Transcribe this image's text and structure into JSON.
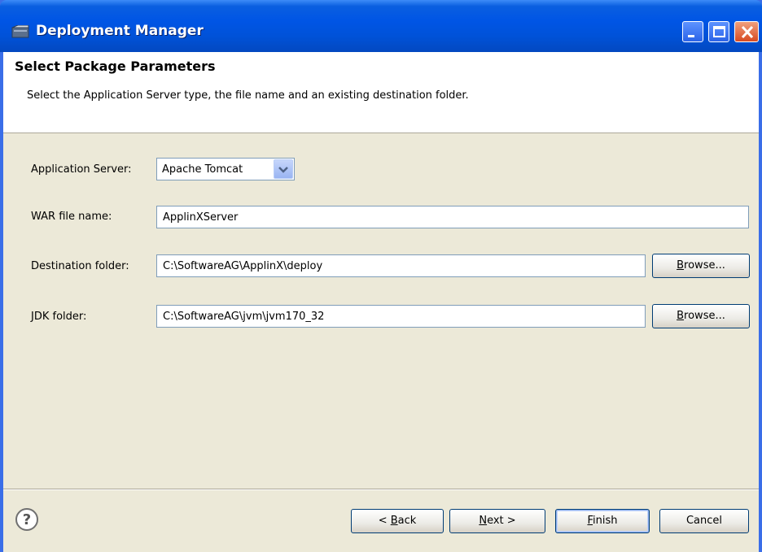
{
  "window": {
    "title": "Deployment Manager"
  },
  "header": {
    "title": "Select Package Parameters",
    "description": "Select the Application Server type, the file name and an existing destination folder."
  },
  "form": {
    "app_server": {
      "label": "Application Server:",
      "value": "Apache Tomcat"
    },
    "war_file": {
      "label": "WAR file name:",
      "value": "ApplinXServer"
    },
    "destination": {
      "label": "Destination folder:",
      "value": "C:\\SoftwareAG\\ApplinX\\deploy",
      "browse_pre": "",
      "browse_key": "B",
      "browse_post": "rowse..."
    },
    "jdk": {
      "label": "JDK folder:",
      "value": "C:\\SoftwareAG\\jvm\\jvm170_32",
      "browse_pre": "",
      "browse_key": "B",
      "browse_post": "rowse..."
    }
  },
  "footer": {
    "back": {
      "pre": "< ",
      "key": "B",
      "post": "ack"
    },
    "next": {
      "pre": "",
      "key": "N",
      "post": "ext >"
    },
    "finish": {
      "pre": "",
      "key": "F",
      "post": "inish"
    },
    "cancel": "Cancel"
  },
  "icons": {
    "app": "window-app-icon",
    "minimize": "minimize-icon",
    "maximize": "maximize-icon",
    "close": "close-icon",
    "dropdown": "chevron-down-icon",
    "help": "help-icon"
  },
  "colors": {
    "titlebar": "#0055e5",
    "dialog_bg": "#ece9d8",
    "header_bg": "#ffffff",
    "input_border": "#7f9db9"
  }
}
